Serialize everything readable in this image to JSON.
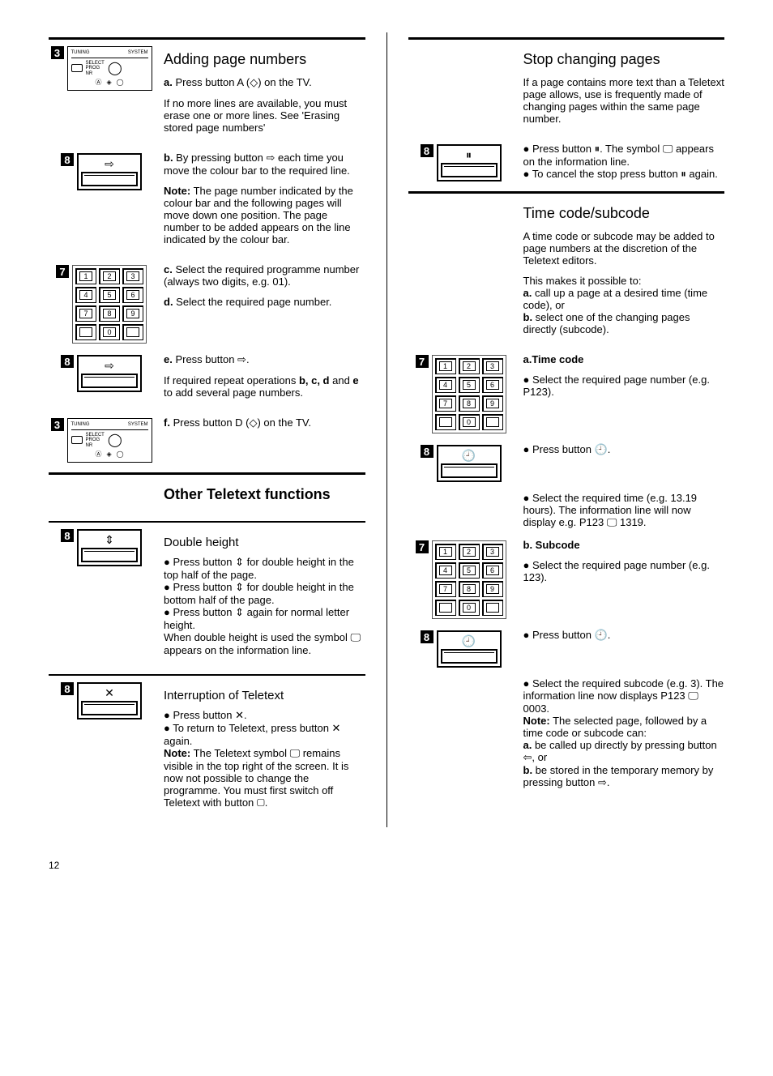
{
  "page_number": "12",
  "left": {
    "sec1_title": "Adding page numbers",
    "a": "a. Press button A (◇) on the TV.",
    "a2": "If no more lines are available, you must erase one or more lines. See 'Erasing stored page numbers'",
    "b": "b. By pressing button ⇨ each time you move the colour bar to the required line.",
    "note1_label": "Note:",
    "note1": " The page number indicated by the colour bar and the following pages will move down one position. The page number to be added appears on the line indicated by the colour bar.",
    "c": "c. Select the required programme number (always two digits, e.g. 01).",
    "d": "d. Select the required page number.",
    "e": "e. Press button ⇨.",
    "e2": "If required repeat operations b, c, d and e to add several page numbers.",
    "f": "f. Press button D (◇) on the TV.",
    "sec2_title": "Other Teletext functions",
    "sub2a": "Double height",
    "dh1": "Press button ⇕ for double height in the top half of the page.",
    "dh2": "Press button ⇕ for double height in the bottom half of the page.",
    "dh3": "Press button ⇕ again for normal letter height.",
    "dh4": "When double height is used the symbol 🖵 appears on the information line.",
    "sub2b": "Interruption of Teletext",
    "int1": "Press button ✕.",
    "int2": "To return to Teletext, press button ✕ again.",
    "int_note_label": "Note:",
    "int_note": " The Teletext symbol 🖵 remains visible in the top right of the screen. It is now not possible to change the programme. You must first switch off Teletext with button ▢."
  },
  "right": {
    "sec1_title": "Stop changing pages",
    "stop1": "If a page contains more text than a Teletext page allows, use is frequently made of changing pages within the same page number.",
    "stop2": "Press button ⏸. The symbol 🖵 appears on the information line.",
    "stop3": "To cancel the stop press button ⏸ again.",
    "sec2_title": "Time code/subcode",
    "tc1": "A time code or subcode may be added to page numbers at the discretion of the Teletext editors.",
    "tc2": "This makes it possible to:",
    "tc2a": "a. call up a page at a desired time (time code), or",
    "tc2b": "b. select one of the changing pages directly (subcode).",
    "tca_label": "a.Time code",
    "tca1": "Select the required page number (e.g. P123).",
    "tca2": "Press button 🕘.",
    "tca3": "Select the required time (e.g. 13.19 hours). The information line will now display e.g. P123 🖵 1319.",
    "tcb_label": "b. Subcode",
    "tcb1": "Select the required page number (e.g. 123).",
    "tcb2": "Press button 🕘.",
    "tcb3": "Select the required subcode (e.g. 3). The information line now displays P123 🖵 0003.",
    "tc_note_label": "Note:",
    "tc_note": " The selected page, followed by a time code or subcode can:",
    "tc_note_a": "a. be called up directly by pressing button ⇦, or",
    "tc_note_b": "b. be stored in the temporary memory by pressing button ⇨."
  }
}
